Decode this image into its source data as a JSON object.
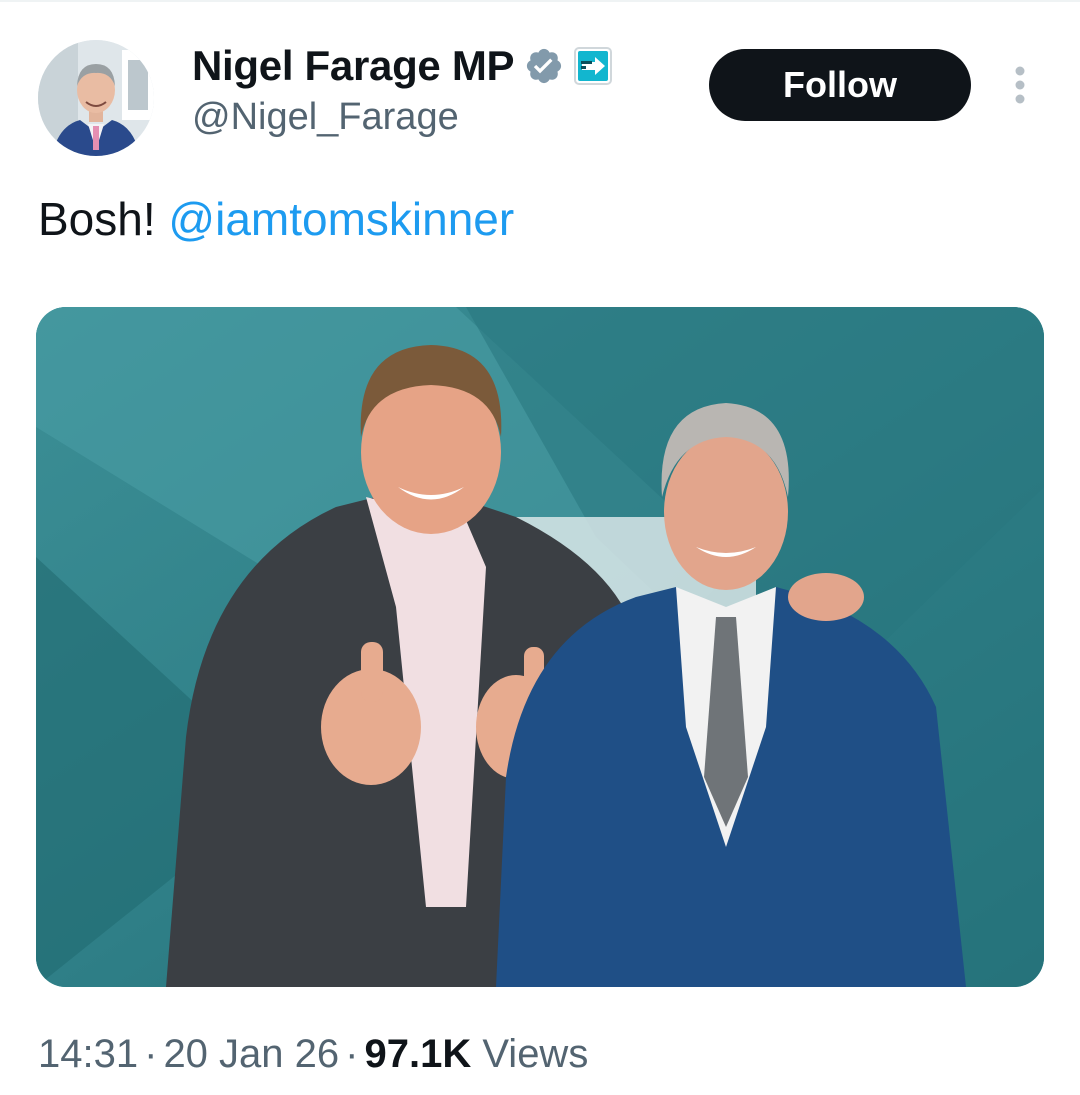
{
  "author": {
    "display_name": "Nigel Farage MP",
    "handle": "@Nigel_Farage",
    "verified_badge_icon": "verified-badge-icon",
    "affiliation_badge_icon": "reform-uk-affiliation-icon",
    "badge_color": "#829aab",
    "affiliation_color": "#12b6cf"
  },
  "header": {
    "follow_label": "Follow",
    "more_icon": "more-options-icon"
  },
  "tweet": {
    "text": "Bosh!",
    "mention": "@iamtomskinner"
  },
  "meta": {
    "time": "14:31",
    "date": "20 Jan 26",
    "views_count": "97.1K",
    "views_label": "Views",
    "separator": "·"
  },
  "colors": {
    "text_primary": "#0f1419",
    "text_secondary": "#536471",
    "link": "#1d9bf0",
    "button_bg": "#0f1419"
  }
}
